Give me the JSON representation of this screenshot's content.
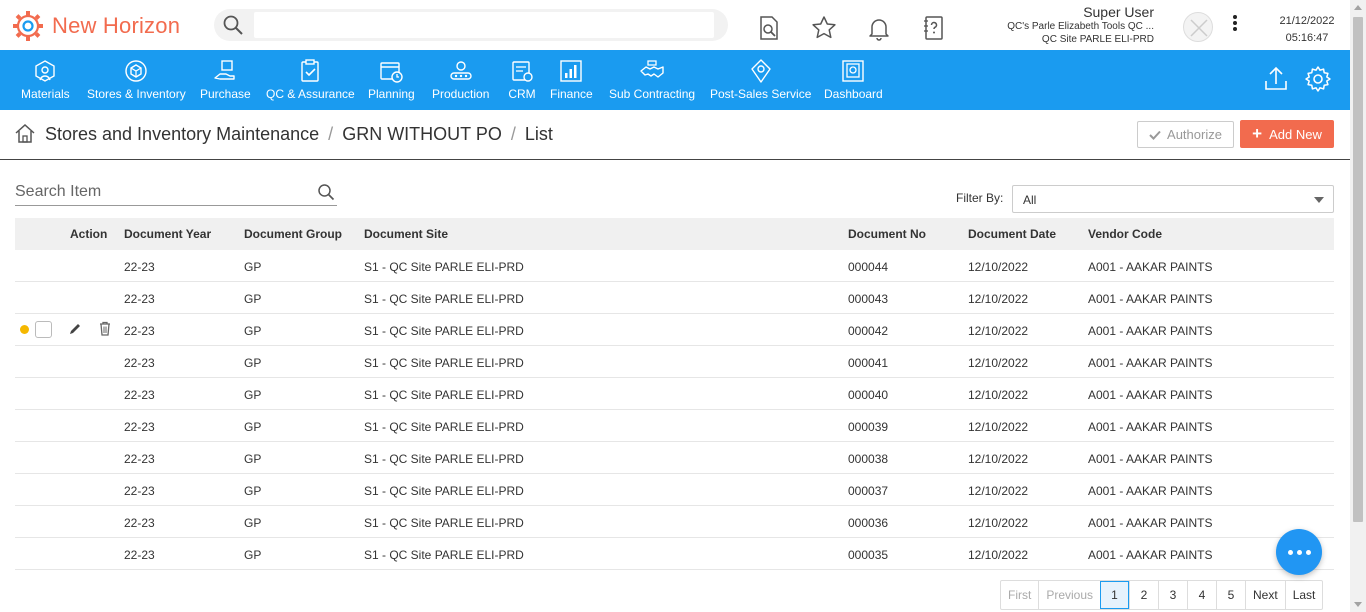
{
  "app": {
    "name": "New Horizon",
    "brand_color": "#f26b4e",
    "accent_color": "#1a9bf0"
  },
  "header": {
    "search_placeholder": "",
    "icons": [
      "document-search-icon",
      "star-icon",
      "bell-icon",
      "help-document-icon"
    ],
    "user": {
      "name": "Super User",
      "company": "QC's Parle Elizabeth Tools QC ...",
      "site": "QC Site PARLE ELI-PRD"
    },
    "date": "21/12/2022",
    "time": "05:16:47"
  },
  "nav": {
    "items": [
      {
        "label": "Materials",
        "icon": "materials-icon"
      },
      {
        "label": "Stores & Inventory",
        "icon": "stores-inventory-icon"
      },
      {
        "label": "Purchase",
        "icon": "purchase-icon"
      },
      {
        "label": "QC & Assurance",
        "icon": "qc-assurance-icon"
      },
      {
        "label": "Planning",
        "icon": "planning-icon"
      },
      {
        "label": "Production",
        "icon": "production-icon"
      },
      {
        "label": "CRM",
        "icon": "crm-icon"
      },
      {
        "label": "Finance",
        "icon": "finance-icon"
      },
      {
        "label": "Sub Contracting",
        "icon": "sub-contracting-icon"
      },
      {
        "label": "Post-Sales Service",
        "icon": "post-sales-icon"
      },
      {
        "label": "Dashboard",
        "icon": "dashboard-icon"
      }
    ],
    "right_icons": [
      "upload-icon",
      "settings-gear-icon"
    ]
  },
  "breadcrumb": {
    "items": [
      "Stores and Inventory Maintenance",
      "GRN WITHOUT PO",
      "List"
    ],
    "authorize_label": "Authorize",
    "add_new_label": "Add New"
  },
  "filters": {
    "search_placeholder": "Search Item",
    "filter_label": "Filter By:",
    "filter_value": "All"
  },
  "table": {
    "columns": [
      "Action",
      "Document Year",
      "Document Group",
      "Document Site",
      "Document No",
      "Document Date",
      "Vendor Code"
    ],
    "rows": [
      {
        "year": "22-23",
        "group": "GP",
        "site": "S1 - QC Site PARLE ELI-PRD",
        "doc_no": "000044",
        "date": "12/10/2022",
        "vendor": "A001 - AAKAR PAINTS"
      },
      {
        "year": "22-23",
        "group": "GP",
        "site": "S1 - QC Site PARLE ELI-PRD",
        "doc_no": "000043",
        "date": "12/10/2022",
        "vendor": "A001 - AAKAR PAINTS"
      },
      {
        "year": "22-23",
        "group": "GP",
        "site": "S1 - QC Site PARLE ELI-PRD",
        "doc_no": "000042",
        "date": "12/10/2022",
        "vendor": "A001 - AAKAR PAINTS",
        "hovered": true
      },
      {
        "year": "22-23",
        "group": "GP",
        "site": "S1 - QC Site PARLE ELI-PRD",
        "doc_no": "000041",
        "date": "12/10/2022",
        "vendor": "A001 - AAKAR PAINTS"
      },
      {
        "year": "22-23",
        "group": "GP",
        "site": "S1 - QC Site PARLE ELI-PRD",
        "doc_no": "000040",
        "date": "12/10/2022",
        "vendor": "A001 - AAKAR PAINTS"
      },
      {
        "year": "22-23",
        "group": "GP",
        "site": "S1 - QC Site PARLE ELI-PRD",
        "doc_no": "000039",
        "date": "12/10/2022",
        "vendor": "A001 - AAKAR PAINTS"
      },
      {
        "year": "22-23",
        "group": "GP",
        "site": "S1 - QC Site PARLE ELI-PRD",
        "doc_no": "000038",
        "date": "12/10/2022",
        "vendor": "A001 - AAKAR PAINTS"
      },
      {
        "year": "22-23",
        "group": "GP",
        "site": "S1 - QC Site PARLE ELI-PRD",
        "doc_no": "000037",
        "date": "12/10/2022",
        "vendor": "A001 - AAKAR PAINTS"
      },
      {
        "year": "22-23",
        "group": "GP",
        "site": "S1 - QC Site PARLE ELI-PRD",
        "doc_no": "000036",
        "date": "12/10/2022",
        "vendor": "A001 - AAKAR PAINTS"
      },
      {
        "year": "22-23",
        "group": "GP",
        "site": "S1 - QC Site PARLE ELI-PRD",
        "doc_no": "000035",
        "date": "12/10/2022",
        "vendor": "A001 - AAKAR PAINTS"
      }
    ]
  },
  "pagination": {
    "first": "First",
    "previous": "Previous",
    "pages": [
      "1",
      "2",
      "3",
      "4",
      "5"
    ],
    "current": "1",
    "next": "Next",
    "last": "Last"
  },
  "chat": {
    "icon": "chat-bubble-icon"
  }
}
